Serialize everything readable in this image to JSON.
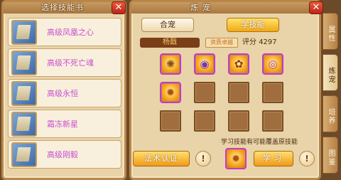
{
  "left_panel": {
    "title": "选择技能书",
    "close_label": "✕",
    "books": [
      {
        "name": "高级凤凰之心"
      },
      {
        "name": "高级不死亡魂"
      },
      {
        "name": "高级永恒"
      },
      {
        "name": "霜冻新星"
      },
      {
        "name": "高级刚毅"
      }
    ]
  },
  "right_panel": {
    "title": "炼宠",
    "close_label": "✕",
    "tabs": {
      "merge": "合宠",
      "learn_skill": "学技能"
    },
    "pet": {
      "name": "杨戬",
      "quality": "资质卓越",
      "score_label": "评分",
      "score_value": "4297"
    },
    "skills": [
      {
        "icon": "phoenix-skill-icon",
        "glyph": "✺"
      },
      {
        "icon": "vortex-skill-icon",
        "glyph": "◉"
      },
      {
        "icon": "beast-skill-icon",
        "glyph": "✿"
      },
      {
        "icon": "swirl-skill-icon",
        "glyph": "◎"
      },
      {
        "icon": "flame-skill-icon",
        "glyph": "✹"
      }
    ],
    "warning_note": "学习技能有可能覆盖原技能",
    "cert_button": "法术认证",
    "learn_button": "学习",
    "info_glyph": "!"
  },
  "side_tabs": [
    {
      "label": "属性",
      "active": false
    },
    {
      "label": "炼宠",
      "active": true
    },
    {
      "label": "培养",
      "active": false
    },
    {
      "label": "图鉴",
      "active": false
    }
  ],
  "colors": {
    "panel_bg": "#e9d3a8",
    "frame": "#b8864a",
    "skill_name": "#c94fd1",
    "gold_button": "#f0a818",
    "close_red": "#d0301c"
  }
}
